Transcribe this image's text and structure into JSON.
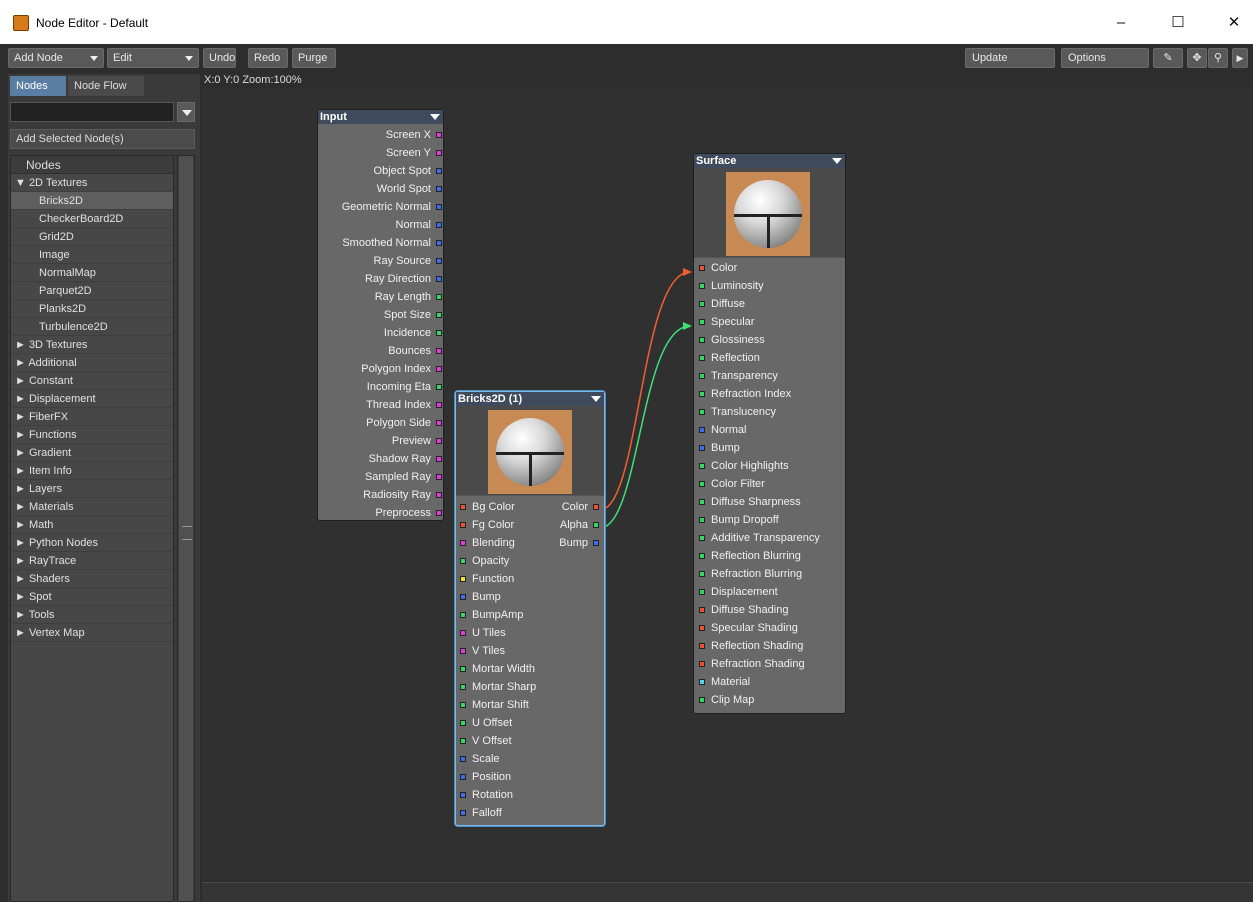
{
  "window": {
    "title": "Node Editor - Default",
    "minimize": "–",
    "maximize": "☐",
    "close": "✕"
  },
  "toolbar": {
    "add_node": "Add Node",
    "edit": "Edit",
    "undo": "Undo",
    "redo": "Redo",
    "purge": "Purge",
    "update": "Update",
    "options": "Options",
    "pen_icon": "✎",
    "move_icon": "✥",
    "zoom_icon": "⚲",
    "play_icon": "▶"
  },
  "coords": "X:0 Y:0 Zoom:100%",
  "sidebar": {
    "tabs": [
      "Nodes",
      "Node Flow"
    ],
    "add_selected": "Add Selected Node(s)",
    "tree_header": "Nodes",
    "tree": [
      {
        "label": "▼ 2D Textures",
        "type": "cat"
      },
      {
        "label": "Bricks2D",
        "type": "child",
        "selected": true
      },
      {
        "label": "CheckerBoard2D",
        "type": "child"
      },
      {
        "label": "Grid2D",
        "type": "child"
      },
      {
        "label": "Image",
        "type": "child"
      },
      {
        "label": "NormalMap",
        "type": "child"
      },
      {
        "label": "Parquet2D",
        "type": "child"
      },
      {
        "label": "Planks2D",
        "type": "child"
      },
      {
        "label": "Turbulence2D",
        "type": "child"
      },
      {
        "label": "► 3D Textures",
        "type": "cat"
      },
      {
        "label": "► Additional",
        "type": "cat"
      },
      {
        "label": "► Constant",
        "type": "cat"
      },
      {
        "label": "► Displacement",
        "type": "cat"
      },
      {
        "label": "► FiberFX",
        "type": "cat"
      },
      {
        "label": "► Functions",
        "type": "cat"
      },
      {
        "label": "► Gradient",
        "type": "cat"
      },
      {
        "label": "► Item Info",
        "type": "cat"
      },
      {
        "label": "► Layers",
        "type": "cat"
      },
      {
        "label": "► Materials",
        "type": "cat"
      },
      {
        "label": "► Math",
        "type": "cat"
      },
      {
        "label": "► Python Nodes",
        "type": "cat"
      },
      {
        "label": "► RayTrace",
        "type": "cat"
      },
      {
        "label": "► Shaders",
        "type": "cat"
      },
      {
        "label": "► Spot",
        "type": "cat"
      },
      {
        "label": "► Tools",
        "type": "cat"
      },
      {
        "label": "► Vertex Map",
        "type": "cat"
      }
    ]
  },
  "colors": {
    "magenta": "#e23ce0",
    "blue": "#3b6ef5",
    "green": "#2fd860",
    "red": "#ee5030",
    "yellow": "#f2e230",
    "cyan": "#4ad7e8"
  },
  "nodes": {
    "input": {
      "title": "Input",
      "outputs": [
        {
          "label": "Screen X",
          "color": "mag"
        },
        {
          "label": "Screen Y",
          "color": "mag"
        },
        {
          "label": "Object Spot",
          "color": "blu"
        },
        {
          "label": "World Spot",
          "color": "blu"
        },
        {
          "label": "Geometric Normal",
          "color": "blu"
        },
        {
          "label": "Normal",
          "color": "blu"
        },
        {
          "label": "Smoothed Normal",
          "color": "blu"
        },
        {
          "label": "Ray Source",
          "color": "blu"
        },
        {
          "label": "Ray Direction",
          "color": "blu"
        },
        {
          "label": "Ray Length",
          "color": "grn"
        },
        {
          "label": "Spot Size",
          "color": "grn"
        },
        {
          "label": "Incidence",
          "color": "grn"
        },
        {
          "label": "Bounces",
          "color": "mag"
        },
        {
          "label": "Polygon Index",
          "color": "mag"
        },
        {
          "label": "Incoming Eta",
          "color": "grn"
        },
        {
          "label": "Thread Index",
          "color": "mag"
        },
        {
          "label": "Polygon Side",
          "color": "mag"
        },
        {
          "label": "Preview",
          "color": "mag"
        },
        {
          "label": "Shadow Ray",
          "color": "mag"
        },
        {
          "label": "Sampled Ray",
          "color": "mag"
        },
        {
          "label": "Radiosity Ray",
          "color": "mag"
        },
        {
          "label": "Preprocess",
          "color": "mag"
        }
      ]
    },
    "bricks": {
      "title": "Bricks2D (1)",
      "inputs": [
        {
          "label": "Bg Color",
          "color": "red"
        },
        {
          "label": "Fg Color",
          "color": "red"
        },
        {
          "label": "Blending",
          "color": "mag"
        },
        {
          "label": "Opacity",
          "color": "grn"
        },
        {
          "label": "Function",
          "color": "yel"
        },
        {
          "label": "Bump",
          "color": "blu"
        },
        {
          "label": "BumpAmp",
          "color": "grn"
        },
        {
          "label": "U Tiles",
          "color": "mag"
        },
        {
          "label": "V Tiles",
          "color": "mag"
        },
        {
          "label": "Mortar Width",
          "color": "grn"
        },
        {
          "label": "Mortar Sharp",
          "color": "grn"
        },
        {
          "label": "Mortar Shift",
          "color": "grn"
        },
        {
          "label": "U Offset",
          "color": "grn"
        },
        {
          "label": "V Offset",
          "color": "grn"
        },
        {
          "label": "Scale",
          "color": "blu"
        },
        {
          "label": "Position",
          "color": "blu"
        },
        {
          "label": "Rotation",
          "color": "blu"
        },
        {
          "label": "Falloff",
          "color": "blu"
        }
      ],
      "outputs": [
        {
          "label": "Color",
          "color": "red"
        },
        {
          "label": "Alpha",
          "color": "grn"
        },
        {
          "label": "Bump",
          "color": "blu"
        }
      ]
    },
    "surface": {
      "title": "Surface",
      "inputs": [
        {
          "label": "Color",
          "color": "red"
        },
        {
          "label": "Luminosity",
          "color": "grn"
        },
        {
          "label": "Diffuse",
          "color": "grn"
        },
        {
          "label": "Specular",
          "color": "grn"
        },
        {
          "label": "Glossiness",
          "color": "grn"
        },
        {
          "label": "Reflection",
          "color": "grn"
        },
        {
          "label": "Transparency",
          "color": "grn"
        },
        {
          "label": "Refraction Index",
          "color": "grn"
        },
        {
          "label": "Translucency",
          "color": "grn"
        },
        {
          "label": "Normal",
          "color": "blu"
        },
        {
          "label": "Bump",
          "color": "blu"
        },
        {
          "label": "Color Highlights",
          "color": "grn"
        },
        {
          "label": "Color Filter",
          "color": "grn"
        },
        {
          "label": "Diffuse Sharpness",
          "color": "grn"
        },
        {
          "label": "Bump Dropoff",
          "color": "grn"
        },
        {
          "label": "Additive Transparency",
          "color": "grn"
        },
        {
          "label": "Reflection Blurring",
          "color": "grn"
        },
        {
          "label": "Refraction Blurring",
          "color": "grn"
        },
        {
          "label": "Displacement",
          "color": "grn"
        },
        {
          "label": "Diffuse Shading",
          "color": "red"
        },
        {
          "label": "Specular Shading",
          "color": "red"
        },
        {
          "label": "Reflection Shading",
          "color": "red"
        },
        {
          "label": "Refraction Shading",
          "color": "red"
        },
        {
          "label": "Material",
          "color": "cya"
        },
        {
          "label": "Clip Map",
          "color": "grn"
        }
      ]
    }
  }
}
